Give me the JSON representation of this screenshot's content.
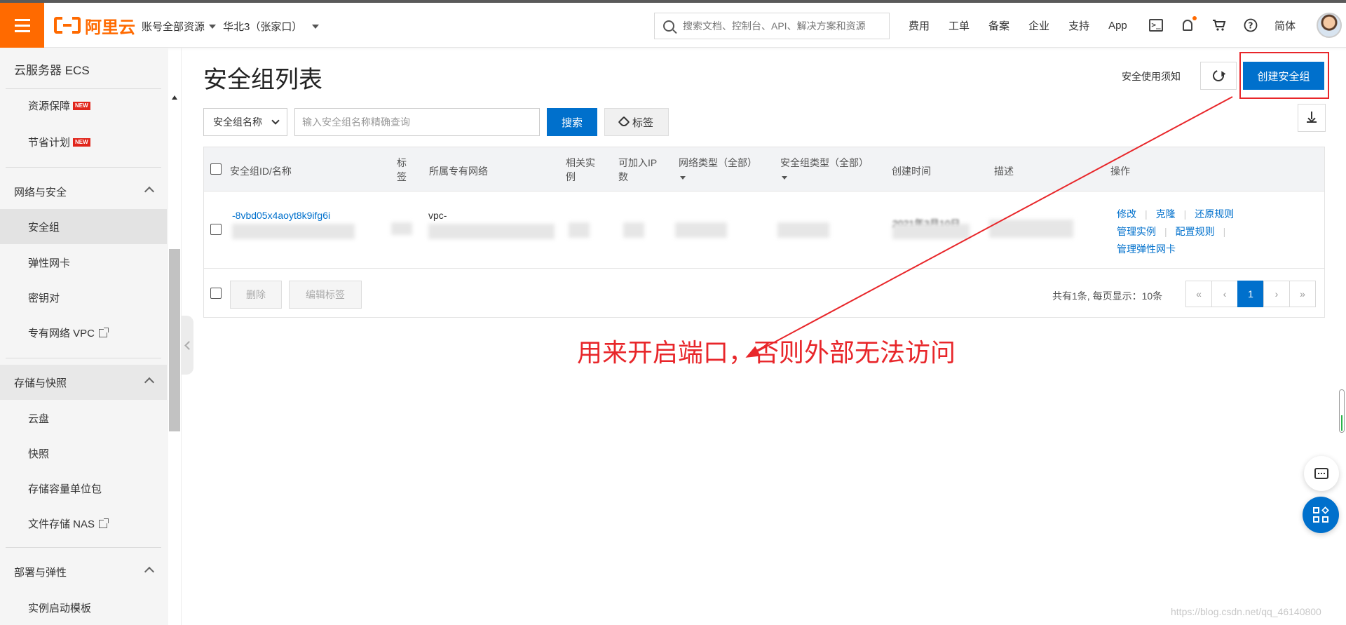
{
  "topbar": {
    "logo_text": "阿里云",
    "account_label": "账号全部资源",
    "region_label": "华北3（张家口）",
    "search_placeholder": "搜索文档、控制台、API、解决方案和资源",
    "links": [
      "费用",
      "工单",
      "备案",
      "企业",
      "支持",
      "App"
    ],
    "lang": "简体",
    "icons": [
      "terminal-icon",
      "bell-icon",
      "cart-icon",
      "help-icon"
    ]
  },
  "sidebar": {
    "title": "云服务器 ECS",
    "items_top": [
      {
        "label": "资源保障",
        "badge": "NEW"
      },
      {
        "label": "节省计划",
        "badge": "NEW"
      }
    ],
    "groups": [
      {
        "label": "网络与安全",
        "items": [
          "安全组",
          "弹性网卡",
          "密钥对",
          "专有网络 VPC"
        ]
      },
      {
        "label": "存储与快照",
        "items": [
          "云盘",
          "快照",
          "存储容量单位包",
          "文件存储 NAS"
        ]
      },
      {
        "label": "部署与弹性",
        "items": [
          "实例启动模板"
        ]
      }
    ],
    "active_item": "安全组"
  },
  "main": {
    "title": "安全组列表",
    "notice_link": "安全使用须知",
    "create_button": "创建安全组",
    "filter": {
      "select_value": "安全组名称",
      "input_placeholder": "输入安全组名称精确查询",
      "search_button": "搜索",
      "tag_button": "标签"
    },
    "table": {
      "headers": {
        "id_name": "安全组ID/名称",
        "tag": "标签",
        "vpc": "所属专有网络",
        "related": "相关实例",
        "joinable_ip": "可加入IP数",
        "network_type": "网络类型（全部）",
        "sg_type": "安全组类型（全部）",
        "created": "创建时间",
        "desc": "描述",
        "ops": "操作"
      },
      "rows": [
        {
          "id_partial": "-8vbd05x4aoyt8k9ifg6i",
          "vpc_partial": "vpc-",
          "created_partial": "2021年3月10日",
          "ops": [
            "修改",
            "克隆",
            "还原规则",
            "管理实例",
            "配置规则",
            "管理弹性网卡"
          ]
        }
      ],
      "footer": {
        "delete_button": "删除",
        "edit_tag_button": "编辑标签",
        "page_info": "共有1条, 每页显示：10条",
        "pages": [
          "«",
          "‹",
          "1",
          "›",
          "»"
        ],
        "current_page": "1"
      }
    }
  },
  "annotation": {
    "text": "用来开启端口，否则外部无法访问",
    "color": "#e8262a"
  },
  "watermark": "https://blog.csdn.net/qq_46140800",
  "colors": {
    "brand": "#ff6a00",
    "primary": "#0070cc",
    "annotation_red": "#e8262a"
  }
}
